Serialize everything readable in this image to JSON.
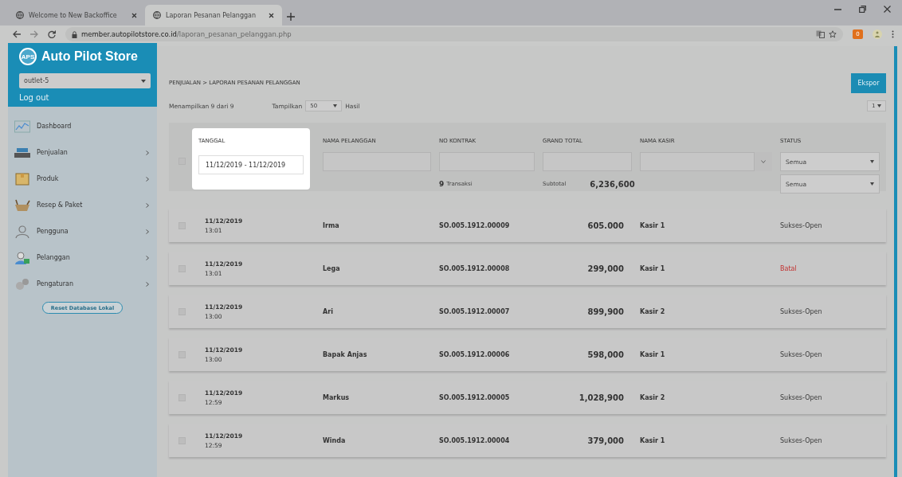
{
  "browser": {
    "tabs": [
      {
        "title": "Welcome to New Backoffice",
        "selected": false
      },
      {
        "title": "Laporan Pesanan Pelanggan",
        "selected": true
      }
    ],
    "url_host": "member.autopilotstore.co.id",
    "url_path": "/laporan_pesanan_pelanggan.php",
    "extension_badge": "0"
  },
  "sidebar": {
    "brand": "Auto Pilot Store",
    "logo": "APS",
    "outlet": "outlet-5",
    "logout": "Log out",
    "items": [
      {
        "label": "Dashboard",
        "has_submenu": false
      },
      {
        "label": "Penjualan",
        "has_submenu": true
      },
      {
        "label": "Produk",
        "has_submenu": true
      },
      {
        "label": "Resep & Paket",
        "has_submenu": true
      },
      {
        "label": "Pengguna",
        "has_submenu": true
      },
      {
        "label": "Pelanggan",
        "has_submenu": true
      },
      {
        "label": "Pengaturan",
        "has_submenu": true
      }
    ],
    "reset_button": "Reset Database Lokal"
  },
  "breadcrumb": "PENJUALAN > LAPORAN PESANAN PELANGGAN",
  "export_button": "Ekspor",
  "summary": "Menampilkan 9 dari 9",
  "page_size_label": "Tampilkan",
  "page_size": "50",
  "page_size_suffix": "Hasil",
  "page": "1",
  "filters": {
    "select_all_checked": false,
    "columns": [
      "TANGGAL",
      "NAMA PELANGGAN",
      "NO KONTRAK",
      "GRAND TOTAL",
      "NAMA KASIR",
      "STATUS"
    ],
    "date_range": "11/12/2019 - 11/12/2019",
    "transaction_count": "9",
    "transaction_label": "Transaksi",
    "subtotal_label": "Subtotal",
    "subtotal": "6,236,600",
    "status_filter": "Semua",
    "status_filter_2": "Semua"
  },
  "rows": [
    {
      "date": "11/12/2019",
      "time": "13:01",
      "customer": "Irma",
      "contract": "SO.005.1912.00009",
      "total": "605.000",
      "cashier": "Kasir 1",
      "status": "Sukses-Open",
      "kind": "open",
      "checked": false
    },
    {
      "date": "11/12/2019",
      "time": "13:01",
      "customer": "Lega",
      "contract": "SO.005.1912.00008",
      "total": "299,000",
      "cashier": "Kasir 1",
      "status": "Batal",
      "kind": "cancelled",
      "checked": false
    },
    {
      "date": "11/12/2019",
      "time": "13:00",
      "customer": "Ari",
      "contract": "SO.005.1912.00007",
      "total": "899,900",
      "cashier": "Kasir 2",
      "status": "Sukses-Open",
      "kind": "open",
      "checked": false
    },
    {
      "date": "11/12/2019",
      "time": "13:00",
      "customer": "Bapak Anjas",
      "contract": "SO.005.1912.00006",
      "total": "598,000",
      "cashier": "Kasir 1",
      "status": "Sukses-Open",
      "kind": "open",
      "checked": false
    },
    {
      "date": "11/12/2019",
      "time": "12:59",
      "customer": "Markus",
      "contract": "SO.005.1912.00005",
      "total": "1,028,900",
      "cashier": "Kasir 2",
      "status": "Sukses-Open",
      "kind": "open",
      "checked": false
    },
    {
      "date": "11/12/2019",
      "time": "12:59",
      "customer": "Winda",
      "contract": "SO.005.1912.00004",
      "total": "379,000",
      "cashier": "Kasir 1",
      "status": "Sukses-Open",
      "kind": "open",
      "checked": false
    }
  ]
}
